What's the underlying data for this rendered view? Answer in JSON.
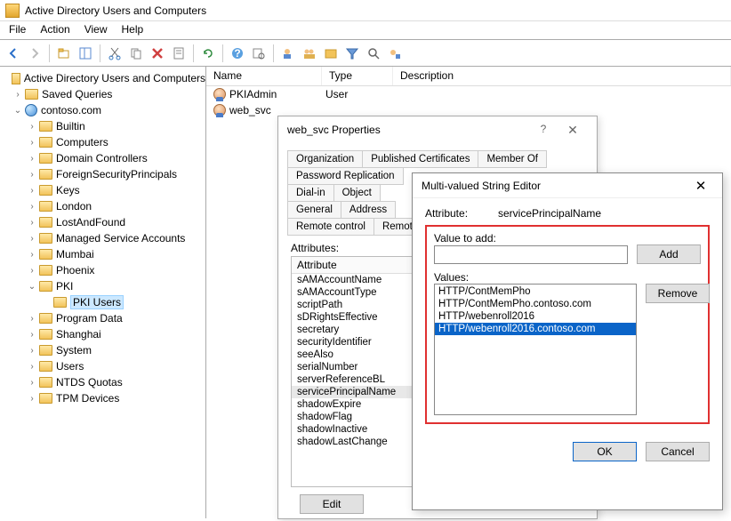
{
  "window": {
    "title": "Active Directory Users and Computers"
  },
  "menu": {
    "file": "File",
    "action": "Action",
    "view": "View",
    "help": "Help"
  },
  "tree": {
    "root": "Active Directory Users and Computers",
    "saved_queries": "Saved Queries",
    "domain": "contoso.com",
    "nodes": {
      "builtin": "Builtin",
      "computers": "Computers",
      "dc": "Domain Controllers",
      "fsp": "ForeignSecurityPrincipals",
      "keys": "Keys",
      "london": "London",
      "laf": "LostAndFound",
      "msa": "Managed Service Accounts",
      "mumbai": "Mumbai",
      "phoenix": "Phoenix",
      "pki": "PKI",
      "pki_users": "PKI Users",
      "program_data": "Program Data",
      "shanghai": "Shanghai",
      "system": "System",
      "users": "Users",
      "ntds": "NTDS Quotas",
      "tpm": "TPM Devices"
    }
  },
  "list": {
    "columns": {
      "name": "Name",
      "type": "Type",
      "description": "Description"
    },
    "rows": [
      {
        "name": "PKIAdmin",
        "type": "User",
        "description": ""
      },
      {
        "name": "web_svc",
        "type": "",
        "description": ""
      }
    ]
  },
  "props": {
    "title": "web_svc Properties",
    "tabs": {
      "organization": "Organization",
      "pubcerts": "Published Certificates",
      "memberof": "Member Of",
      "pwdrepl": "Password Replication",
      "dialin": "Dial-in",
      "object": "Object",
      "general": "General",
      "address": "Address",
      "remotectrl": "Remote control",
      "remoted": "Remote D"
    },
    "attr_label": "Attributes:",
    "attr_header": "Attribute",
    "attributes": [
      "sAMAccountName",
      "sAMAccountType",
      "scriptPath",
      "sDRightsEffective",
      "secretary",
      "securityIdentifier",
      "seeAlso",
      "serialNumber",
      "serverReferenceBL",
      "servicePrincipalName",
      "shadowExpire",
      "shadowFlag",
      "shadowInactive",
      "shadowLastChange"
    ],
    "edit_btn": "Edit"
  },
  "mv": {
    "title": "Multi-valued String Editor",
    "attr_label": "Attribute:",
    "attr_value": "servicePrincipalName",
    "value_to_add": "Value to add:",
    "add": "Add",
    "values_label": "Values:",
    "values": [
      "HTTP/ContMemPho",
      "HTTP/ContMemPho.contoso.com",
      "HTTP/webenroll2016",
      "HTTP/webenroll2016.contoso.com"
    ],
    "remove": "Remove",
    "ok": "OK",
    "cancel": "Cancel"
  }
}
